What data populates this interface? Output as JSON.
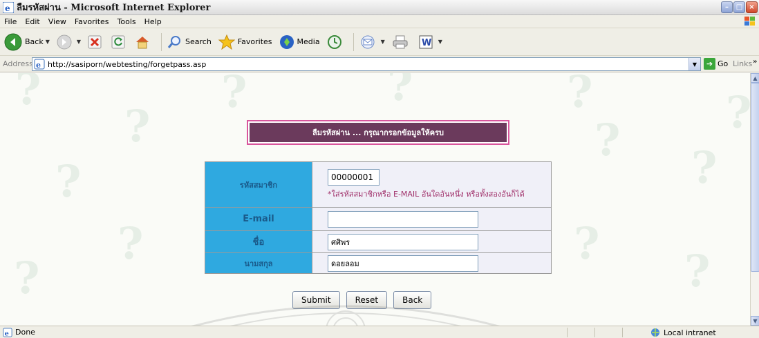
{
  "window": {
    "title": "ลืมรหัสผ่าน - Microsoft Internet Explorer",
    "controls": {
      "minimize": "–",
      "maximize": "□",
      "close": "×"
    }
  },
  "menu": [
    "File",
    "Edit",
    "View",
    "Favorites",
    "Tools",
    "Help"
  ],
  "toolbar": {
    "back_label": "Back",
    "search_label": "Search",
    "favorites_label": "Favorites",
    "media_label": "Media"
  },
  "address": {
    "label": "Address",
    "url": "http://sasiporn/webtesting/forgetpass.asp",
    "go_label": "Go",
    "links_label": "Links"
  },
  "page": {
    "banner": "ลืมรหัสผ่าน ... กรุณากรอกข้อมูลให้ครบ",
    "fields": {
      "member_id_label": "รหัสสมาชิก",
      "member_id_value": "00000001",
      "hint": "*ใส่รหัสสมาชิกหรือ E-MAIL อันใดอันหนึ่ง หรือทั้งสองอันก็ได้",
      "email_label": "E-mail",
      "email_value": "",
      "firstname_label": "ชื่อ",
      "firstname_value": "ศศิพร",
      "lastname_label": "นามสกุล",
      "lastname_value": "ดอยลอม"
    },
    "buttons": {
      "submit": "Submit",
      "reset": "Reset",
      "back": "Back"
    }
  },
  "status": {
    "text": "Done",
    "zone": "Local intranet"
  },
  "icons": [
    "ie-icon",
    "windows-flag-icon",
    "back-icon",
    "forward-icon",
    "stop-icon",
    "refresh-icon",
    "home-icon",
    "search-icon",
    "favorites-star-icon",
    "media-icon",
    "history-icon",
    "mail-icon",
    "print-icon",
    "edit-icon",
    "page-icon",
    "go-arrow-icon",
    "zone-icon"
  ]
}
